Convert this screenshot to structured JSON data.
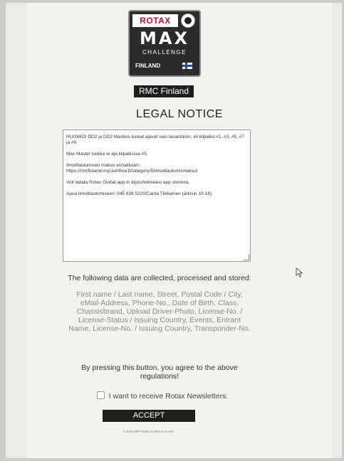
{
  "logo": {
    "brand": "ROTAX",
    "max": "MAX",
    "challenge": "CHALLENGE",
    "country": "FINLAND"
  },
  "site_name": "RMC Finland",
  "title": "LEGAL NOTICE",
  "notice": {
    "p1": "HUOMIO! DD2 ja DD2 Masters luokat ajavat vain lauantaisin, eli kilpailut #1, #3, #5, #7 ja #9",
    "p2": "Max Master luokka ei aja kilpailussa #5.",
    "p3": "Ilmoittautumisen maksu ennakkoon: https://rmcfinland.mycashflow.fi/category/5/ilmoittautumismaksut",
    "p4": "Voit ladata Rotax Global app:in älypuhelimeesi app storesta.",
    "p5": "Apua ilmoittautumiseen: 045 638 5220/Carita Tiikkainen (arkisin 10-16)"
  },
  "data_intro": "The following data are collected, processed and stored:",
  "data_list": "First name / Last name, Street, Postal Code / City, eMail-Address, Phone-No., Date of Birth, Class, Chassisbrand, Upload Driver-Photo, License-No. / License-Status / Issuing Country, Events, Entrant Name, License-No. / Issuing Country, Transponder-No.",
  "agree_text": "By pressing this button, you agree to the above regulations!",
  "newsletter_label": "I want to receive Rotax Newsletters.",
  "newsletter_checked": false,
  "accept_label": "ACCEPT",
  "copyright": "© 2019 BRP-Rotax GmbH & Co KG"
}
